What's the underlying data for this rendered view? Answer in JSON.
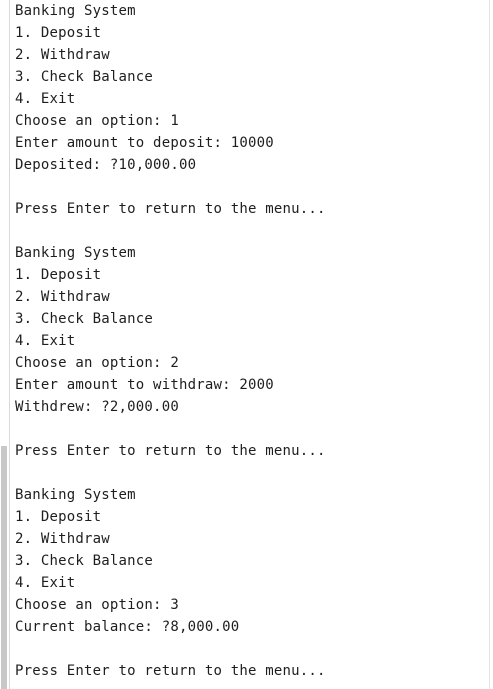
{
  "console": {
    "lines": [
      "Banking System",
      "1. Deposit",
      "2. Withdraw",
      "3. Check Balance",
      "4. Exit",
      "Choose an option: 1",
      "Enter amount to deposit: 10000",
      "Deposited: ?10,000.00",
      "",
      "Press Enter to return to the menu...",
      "",
      "Banking System",
      "1. Deposit",
      "2. Withdraw",
      "3. Check Balance",
      "4. Exit",
      "Choose an option: 2",
      "Enter amount to withdraw: 2000",
      "Withdrew: ?2,000.00",
      "",
      "Press Enter to return to the menu...",
      "",
      "Banking System",
      "1. Deposit",
      "2. Withdraw",
      "3. Check Balance",
      "4. Exit",
      "Choose an option: 3",
      "Current balance: ?8,000.00",
      "",
      "Press Enter to return to the menu..."
    ]
  }
}
